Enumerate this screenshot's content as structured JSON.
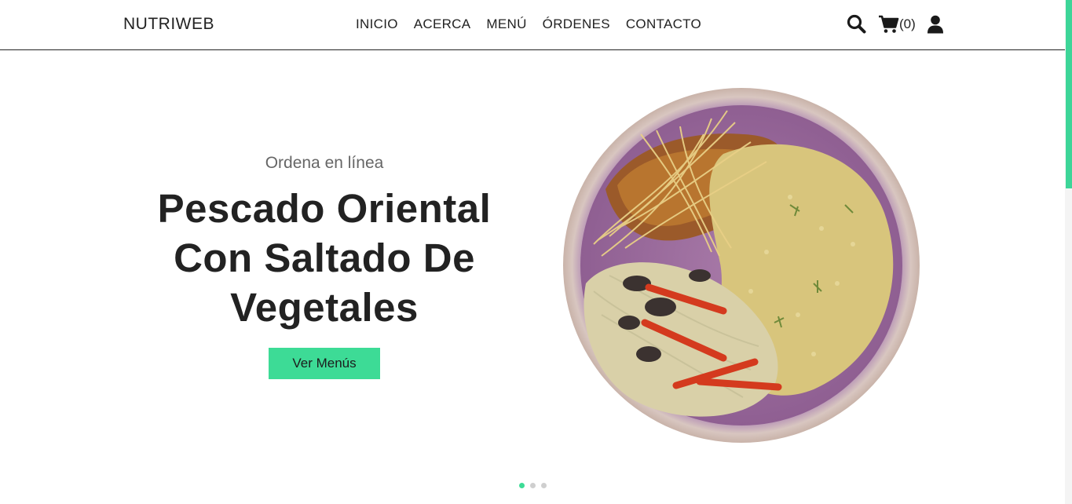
{
  "brand": "NUTRIWEB",
  "nav": {
    "links": [
      "INICIO",
      "ACERCA",
      "MENÚ",
      "ÓRDENES",
      "CONTACTO"
    ],
    "cart_count": "(0)",
    "icons": {
      "search": "search-icon",
      "cart": "cart-icon",
      "user": "user-icon"
    }
  },
  "hero": {
    "subtitle": "Ordena en línea",
    "title": "Pescado Oriental Con Saltado De Vegetales",
    "button_label": "Ver Menús",
    "image": "plate-of-fish-quinoa-vegetables"
  },
  "carousel": {
    "slides": 3,
    "active": 1
  },
  "colors": {
    "accent": "#3ddb96",
    "text": "#222222",
    "muted": "#666666"
  }
}
